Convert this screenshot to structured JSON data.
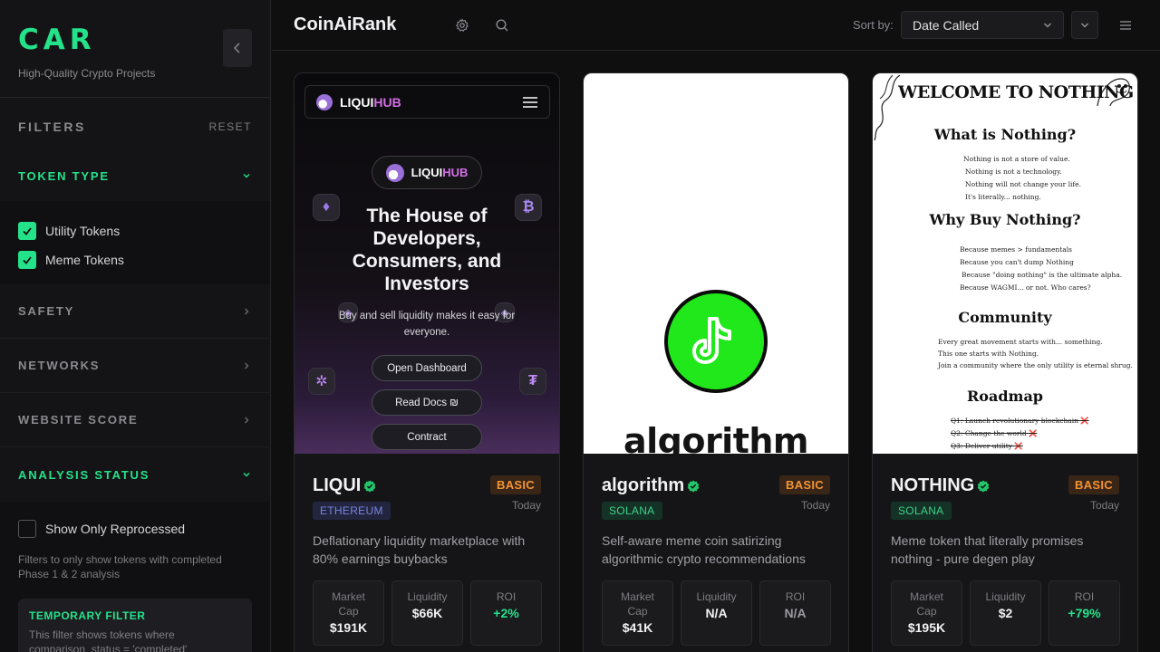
{
  "sidebar": {
    "brand_name": "CAR",
    "brand_tagline": "High-Quality Crypto Projects",
    "filters_title": "FILTERS",
    "reset_label": "RESET",
    "sections": {
      "token_type": "TOKEN TYPE",
      "safety": "SAFETY",
      "networks": "NETWORKS",
      "website_score": "WEBSITE SCORE",
      "analysis_status": "ANALYSIS STATUS"
    },
    "token_types": [
      {
        "label": "Utility Tokens",
        "checked": true
      },
      {
        "label": "Meme Tokens",
        "checked": true
      }
    ],
    "reprocessed_label": "Show Only Reprocessed",
    "reprocessed_checked": false,
    "analysis_note": "Filters to only show tokens with completed Phase 1 & 2 analysis",
    "temp_filter_title": "TEMPORARY FILTER",
    "temp_filter_text": "This filter shows tokens where comparison_status = 'completed'"
  },
  "header": {
    "title": "CoinAiRank",
    "sort_label": "Sort by:",
    "sort_value": "Date Called"
  },
  "cards": [
    {
      "name": "LIQUI",
      "tier": "BASIC",
      "network": "ETHEREUM",
      "date": "Today",
      "description": "Deflationary liquidity marketplace with 80% earnings buybacks",
      "market_cap_label": "Market Cap",
      "market_cap": "$191K",
      "liquidity_label": "Liquidity",
      "liquidity": "$66K",
      "roi_label": "ROI",
      "roi": "+2%",
      "preview": {
        "logo_white": "LIQUI",
        "logo_pink": "HUB",
        "headline": "The House of Developers, Consumers, and Investors",
        "subtext": "Buy and sell liquidity makes it easy for everyone.",
        "buttons": [
          "Open Dashboard",
          "Read Docs ₪",
          "Contract"
        ]
      }
    },
    {
      "name": "algorithm",
      "tier": "BASIC",
      "network": "SOLANA",
      "date": "Today",
      "description": "Self-aware meme coin satirizing algorithmic crypto recommendations",
      "market_cap_label": "Market Cap",
      "market_cap": "$41K",
      "liquidity_label": "Liquidity",
      "liquidity": "N/A",
      "roi_label": "ROI",
      "roi": "N/A",
      "preview": {
        "word": "algorithm"
      }
    },
    {
      "name": "NOTHING",
      "tier": "BASIC",
      "network": "SOLANA",
      "date": "Today",
      "description": "Meme token that literally promises nothing - pure degen play",
      "market_cap_label": "Market Cap",
      "market_cap": "$195K",
      "liquidity_label": "Liquidity",
      "liquidity": "$2",
      "roi_label": "ROI",
      "roi": "+79%",
      "preview": {
        "title": "WELCOME TO NOTHING",
        "h1": "What is Nothing?",
        "l1": [
          "Nothing is not a store of value.",
          "Nothing is not a technology.",
          "Nothing will not change your life.",
          "It's literally... nothing."
        ],
        "h2": "Why Buy Nothing?",
        "l2": [
          "Because memes > fundamentals",
          "Because you can't dump Nothing",
          "Because \"doing nothing\" is the ultimate alpha.",
          "Because WAGMI... or not. Who cares?"
        ],
        "h3": "Community",
        "l3": [
          "Every great movement starts with... something.",
          "This one starts with Nothing.",
          "Join a community where the only utility is eternal shrug."
        ],
        "h4": "Roadmap",
        "l4": [
          "Q1: Launch revolutionary blockchain ❌",
          "Q2: Change the world ❌",
          "Q3: Deliver utility ❌"
        ]
      }
    }
  ]
}
